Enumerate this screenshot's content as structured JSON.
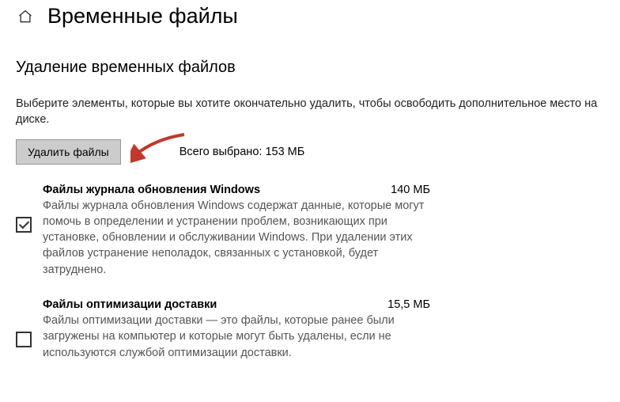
{
  "header": {
    "title": "Временные файлы"
  },
  "section": {
    "heading": "Удаление временных файлов",
    "instruction": "Выберите элементы, которые вы хотите окончательно удалить, чтобы освободить дополнительное место на диске.",
    "delete_button_label": "Удалить файлы",
    "total_selected_label": "Всего выбрано: 153 МБ"
  },
  "items": [
    {
      "checked": true,
      "title": "Файлы журнала обновления Windows",
      "size": "140 МБ",
      "description": "Файлы журнала обновления Windows содержат данные, которые могут помочь в определении и устранении проблем, возникающих при установке, обновлении и обслуживании Windows. При удалении этих файлов устранение неполадок, связанных с установкой, будет затруднено."
    },
    {
      "checked": false,
      "title": "Файлы оптимизации доставки",
      "size": "15,5 МБ",
      "description": "Файлы оптимизации доставки — это файлы, которые ранее были загружены на компьютер и которые могут быть удалены, если не используются службой оптимизации доставки."
    }
  ]
}
